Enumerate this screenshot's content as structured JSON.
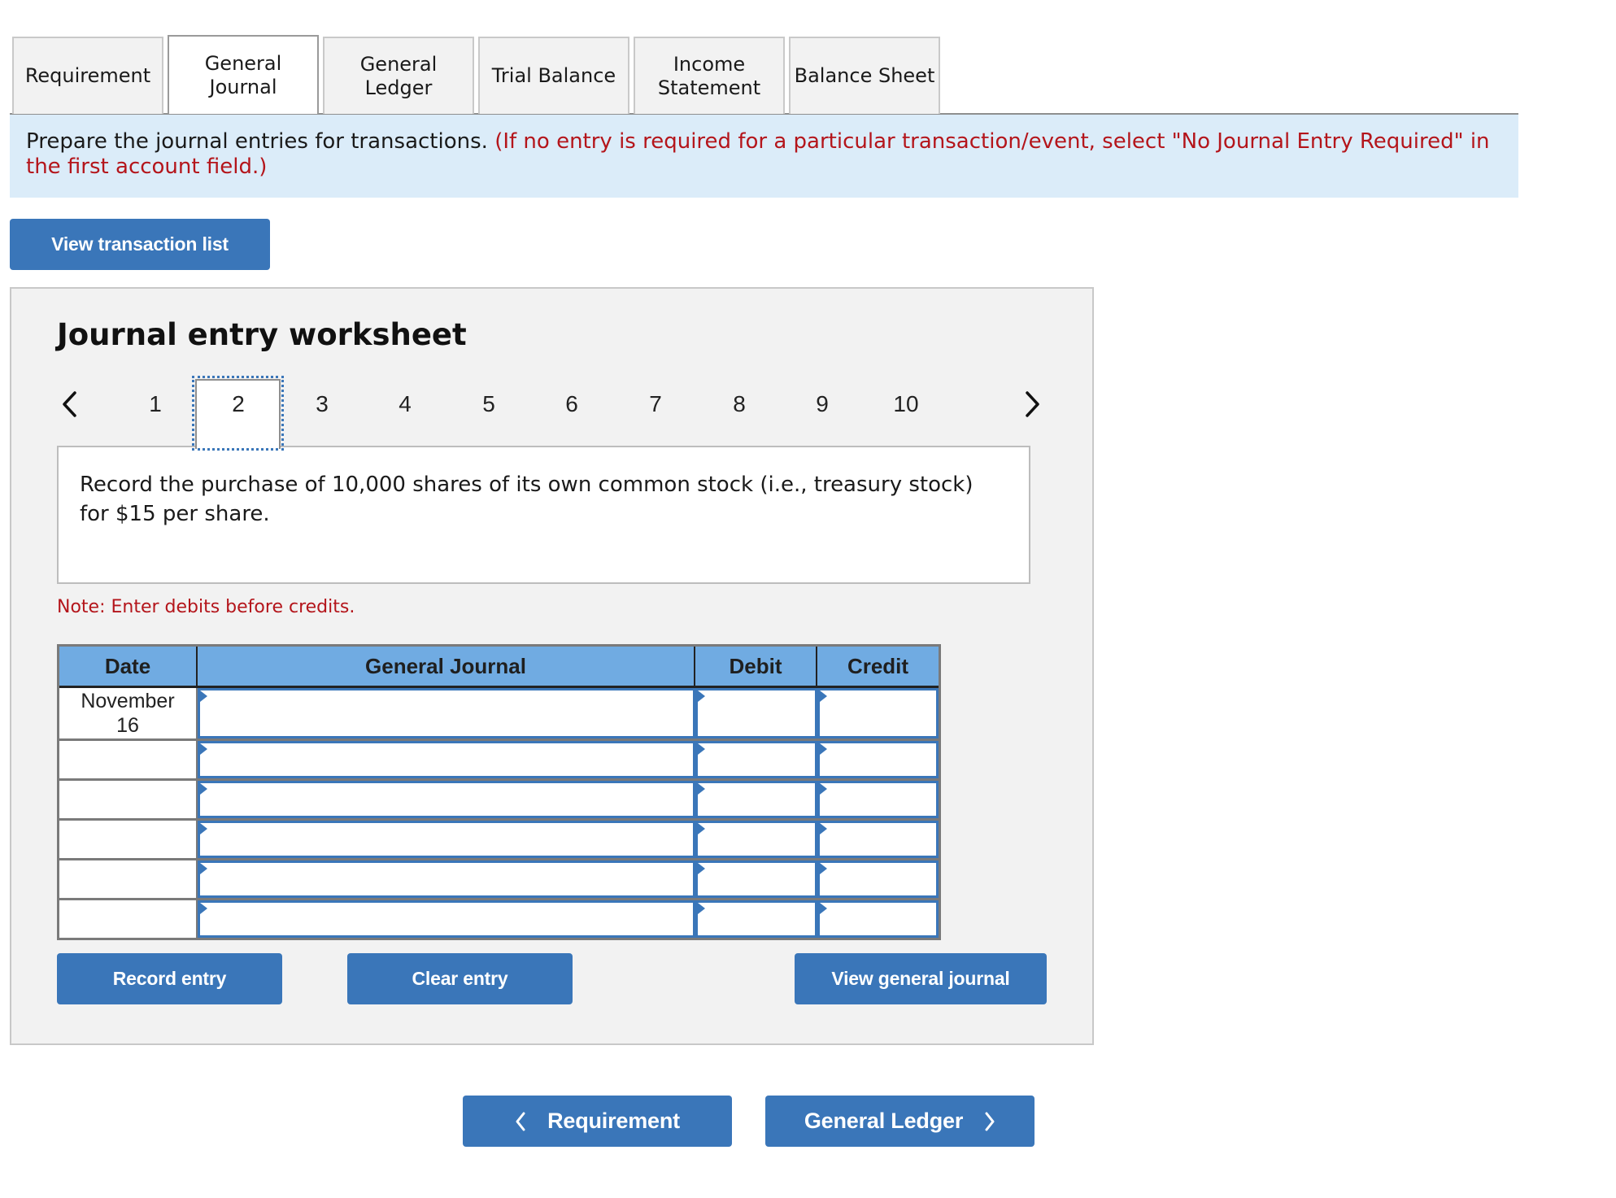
{
  "tabs": [
    {
      "label": "Requirement",
      "active": false
    },
    {
      "label": "General\nJournal",
      "active": true
    },
    {
      "label": "General\nLedger",
      "active": false
    },
    {
      "label": "Trial Balance",
      "active": false
    },
    {
      "label": "Income\nStatement",
      "active": false
    },
    {
      "label": "Balance Sheet",
      "active": false
    }
  ],
  "instructions": {
    "main": "Prepare the journal entries for transactions.",
    "note_red": "(If no entry is required for a particular transaction/event, select \"No Journal Entry Required\" in the first account field.)"
  },
  "view_transaction_list_label": "View transaction list",
  "worksheet": {
    "title": "Journal entry worksheet",
    "pager": {
      "prev_icon": "chevron-left-icon",
      "next_icon": "chevron-right-icon",
      "pages": [
        "1",
        "2",
        "3",
        "4",
        "5",
        "6",
        "7",
        "8",
        "9",
        "10"
      ],
      "selected": "2"
    },
    "description": "Record the purchase of 10,000 shares of its own common stock (i.e., treasury stock) for $15 per share.",
    "note": "Note: Enter debits before credits.",
    "table": {
      "headers": {
        "date": "Date",
        "account": "General Journal",
        "debit": "Debit",
        "credit": "Credit"
      },
      "rows": [
        {
          "date": "November\n16",
          "account": "",
          "debit": "",
          "credit": ""
        },
        {
          "date": "",
          "account": "",
          "debit": "",
          "credit": ""
        },
        {
          "date": "",
          "account": "",
          "debit": "",
          "credit": ""
        },
        {
          "date": "",
          "account": "",
          "debit": "",
          "credit": ""
        },
        {
          "date": "",
          "account": "",
          "debit": "",
          "credit": ""
        },
        {
          "date": "",
          "account": "",
          "debit": "",
          "credit": ""
        }
      ]
    },
    "buttons": {
      "record": "Record entry",
      "clear": "Clear entry",
      "view_general_journal": "View general journal"
    }
  },
  "nav": {
    "prev_label": "Requirement",
    "next_label": "General Ledger"
  },
  "colors": {
    "accent_button": "#3a76b9",
    "banner_bg": "#dbecf9",
    "warning_text": "#b4151b",
    "table_header": "#70abe2"
  }
}
